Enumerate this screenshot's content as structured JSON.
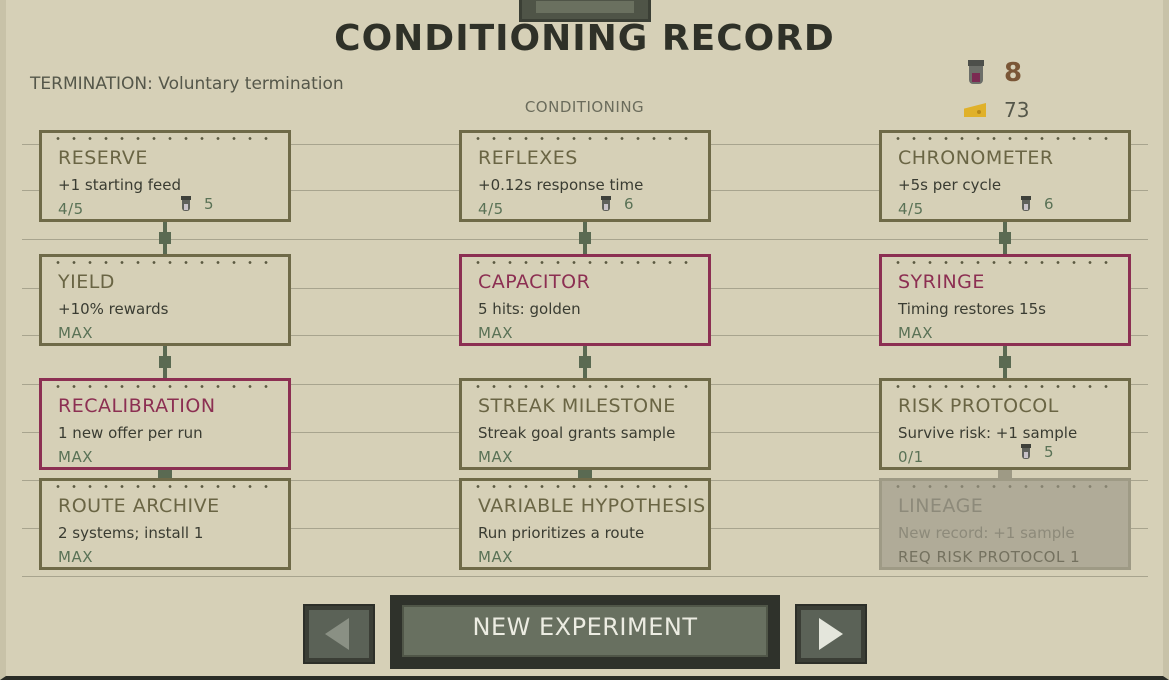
{
  "header": {
    "title": "CONDITIONING RECORD",
    "termination": "TERMINATION: Voluntary termination",
    "section_label": "CONDITIONING"
  },
  "resources": {
    "samples": {
      "icon": "sample-vial-icon",
      "count": "8"
    },
    "cheese": {
      "icon": "cheese-icon",
      "count": "73"
    }
  },
  "cards": {
    "reserve": {
      "name": "RESERVE",
      "desc": "+1 starting feed",
      "status": "4/5",
      "cost": "5"
    },
    "reflexes": {
      "name": "REFLEXES",
      "desc": "+0.12s response time",
      "status": "4/5",
      "cost": "6"
    },
    "chronometer": {
      "name": "CHRONOMETER",
      "desc": "+5s per cycle",
      "status": "4/5",
      "cost": "6"
    },
    "yield": {
      "name": "YIELD",
      "desc": "+10% rewards",
      "status": "MAX"
    },
    "capacitor": {
      "name": "CAPACITOR",
      "desc": "5 hits: golden",
      "status": "MAX"
    },
    "syringe": {
      "name": "SYRINGE",
      "desc": "Timing restores 15s",
      "status": "MAX"
    },
    "recalibration": {
      "name": "RECALIBRATION",
      "desc": "1 new offer per run",
      "status": "MAX"
    },
    "streak_milestone": {
      "name": "STREAK MILESTONE",
      "desc": "Streak goal grants sample",
      "status": "MAX"
    },
    "risk_protocol": {
      "name": "RISK PROTOCOL",
      "desc": "Survive risk: +1 sample",
      "status": "0/1",
      "cost": "5"
    },
    "route_archive": {
      "name": "ROUTE ARCHIVE",
      "desc": "2 systems; install 1",
      "status": "MAX"
    },
    "variable_hypothesis": {
      "name": "VARIABLE HYPOTHESIS",
      "desc": "Run prioritizes a route",
      "status": "MAX"
    },
    "lineage": {
      "name": "LINEAGE",
      "desc": "New record: +1 sample",
      "status": "REQ RISK PROTOCOL 1"
    }
  },
  "footer": {
    "new_experiment": "NEW EXPERIMENT",
    "prev_icon": "arrow-left-icon",
    "next_icon": "arrow-right-icon"
  },
  "colors": {
    "background": "#d6d0b7",
    "card_border": "#6f6a48",
    "maxed_border": "#8c2f52",
    "status_green": "#5a7256",
    "sample_count": "#7a5636",
    "locked_card": "#b0ab98"
  }
}
